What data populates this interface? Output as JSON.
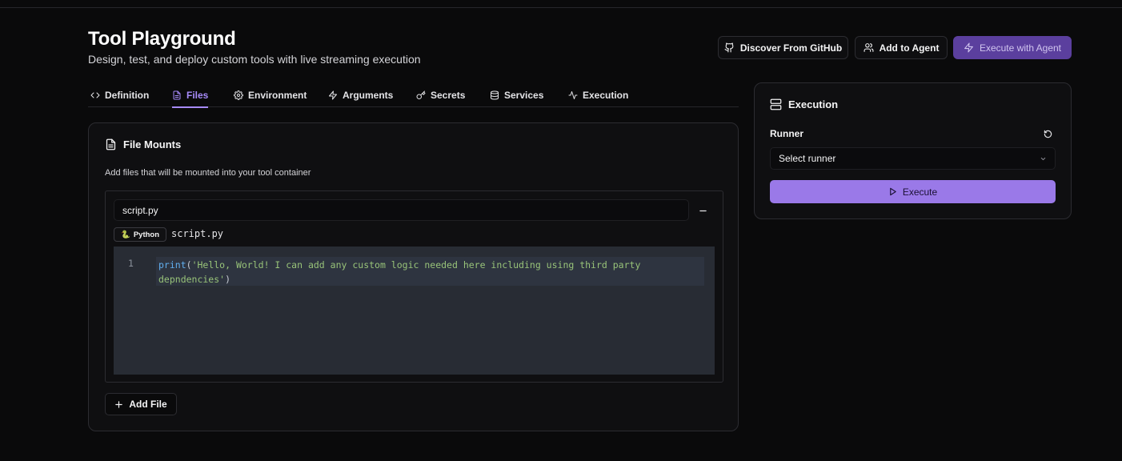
{
  "header": {
    "title": "Tool Playground",
    "subtitle": "Design, test, and deploy custom tools with live streaming execution",
    "discover_label": "Discover From GitHub",
    "add_agent_label": "Add to Agent",
    "execute_agent_label": "Execute with Agent"
  },
  "tabs": [
    {
      "label": "Definition",
      "icon": "code-icon"
    },
    {
      "label": "Files",
      "icon": "file-icon",
      "active": true
    },
    {
      "label": "Environment",
      "icon": "gear-icon"
    },
    {
      "label": "Arguments",
      "icon": "bolt-icon"
    },
    {
      "label": "Secrets",
      "icon": "key-icon"
    },
    {
      "label": "Services",
      "icon": "database-icon"
    },
    {
      "label": "Execution",
      "icon": "activity-icon"
    }
  ],
  "file_mounts": {
    "title": "File Mounts",
    "description": "Add files that will be mounted into your tool container",
    "files": [
      {
        "filename": "script.py",
        "language": "Python",
        "language_icon": "🐍",
        "display_name": "script.py",
        "line_number": "1",
        "code_fn": "print",
        "code_open": "(",
        "code_str": "'Hello, World! I can add any custom logic needed here including using third party depndencies'",
        "code_close": ")"
      }
    ],
    "add_file_label": "Add File"
  },
  "execution": {
    "title": "Execution",
    "runner_label": "Runner",
    "runner_value": "Select runner",
    "execute_label": "Execute"
  },
  "colors": {
    "accent": "#a78bfa",
    "execute_button": "#9a79e8",
    "execute_with_agent_button": "#5b3f9e",
    "background": "#0a0a0b"
  }
}
